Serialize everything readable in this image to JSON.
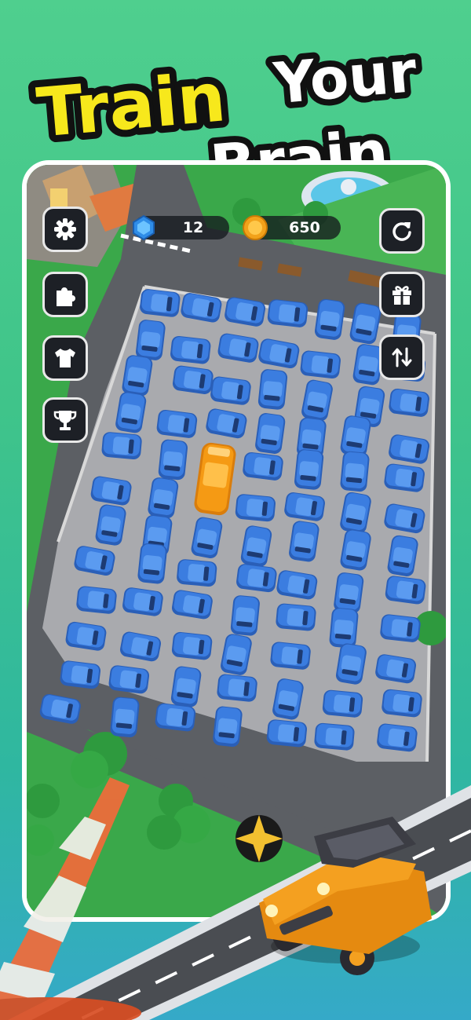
{
  "headline": {
    "line1_word1": "Train",
    "line1_word2": "Your",
    "line2": "Brain"
  },
  "hud": {
    "gems": "12",
    "coins": "650",
    "left_buttons": [
      "gear-icon",
      "puzzle-icon",
      "shirt-icon",
      "trophy-icon"
    ],
    "right_buttons": [
      "restart-icon",
      "gift-icon",
      "swap-icon"
    ]
  },
  "colors": {
    "background_green": "#3fc48a",
    "headline_yellow": "#f7e81c",
    "headline_white": "#ffffff",
    "car_blue": "#3b7de0",
    "bus_orange": "#f59a14",
    "jeep_orange": "#f4a020"
  }
}
